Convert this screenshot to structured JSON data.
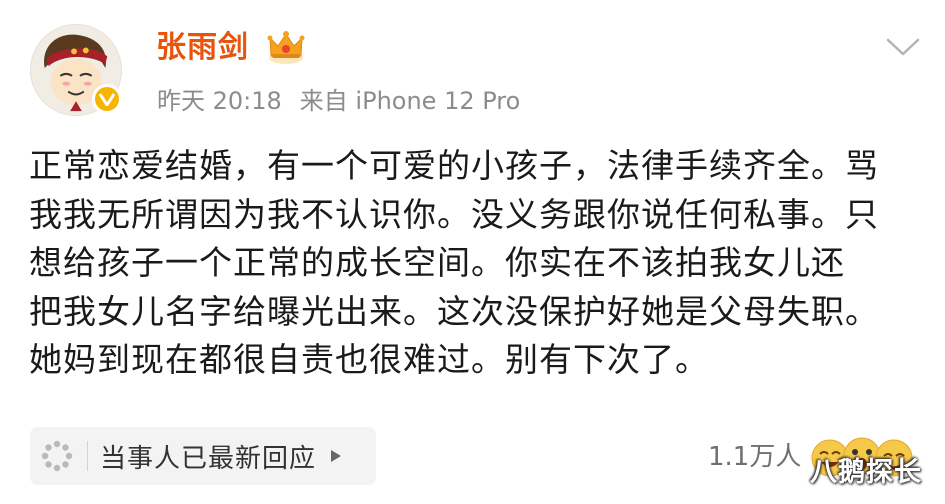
{
  "post": {
    "author": {
      "name": "张雨剑",
      "verified": true
    },
    "meta": {
      "time": "昨天 20:18",
      "source": "来自 iPhone 12 Pro"
    },
    "body_lines": [
      "正常恋爱结婚，有一个可爱的小孩子，法律手续齐全。骂",
      "我我无所谓因为我不认识你。没义务跟你说任何私事。只",
      "想给孩子一个正常的成长空间。你实在不该拍我女儿还",
      "把我女儿名字给曝光出来。这次没保护好她是父母失职。",
      "她妈到现在都很自责也很难过。别有下次了。"
    ],
    "response": {
      "label": "当事人已最新回应"
    },
    "likes": {
      "count": "1.1万人"
    },
    "watermark": "八鹅探长",
    "icons": {
      "crown": "crown-icon",
      "expand": "chevron-down-icon",
      "loading": "loading-dots-icon",
      "play": "play-arrow-icon",
      "verified": "verified-v-icon",
      "reactions": "emoji-reactions-icon"
    },
    "colors": {
      "username": "#e8540c",
      "meta": "#8c8c8c",
      "body": "#1a1a1a",
      "pill_bg": "#f3f3f3",
      "verified_badge": "#f7b500"
    }
  }
}
